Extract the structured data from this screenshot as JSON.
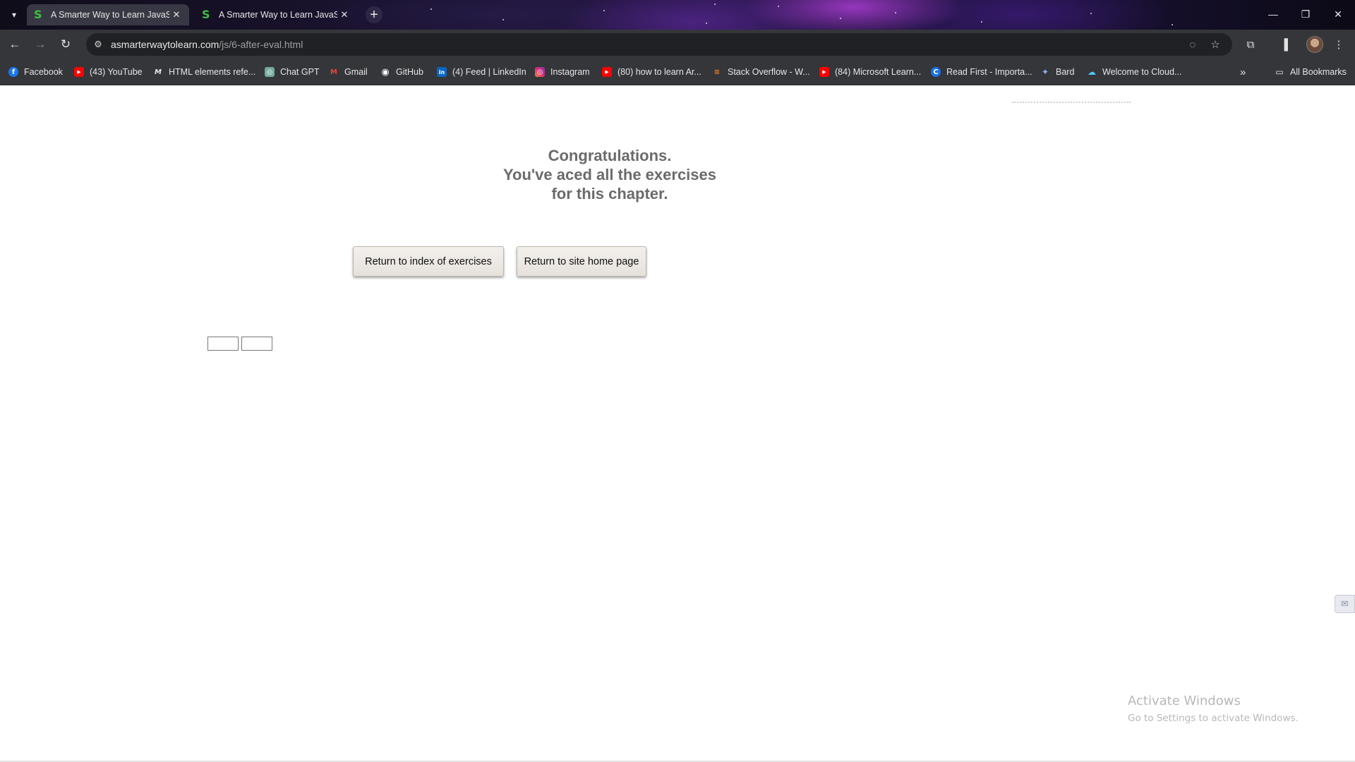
{
  "browser": {
    "tabs": [
      {
        "title": "A Smarter Way to Learn JavaScr",
        "favicon": "S",
        "active": true
      },
      {
        "title": "A Smarter Way to Learn JavaScr",
        "favicon": "S",
        "active": false
      }
    ],
    "url_domain": "asmarterwaytolearn.com",
    "url_path": "/js/6-after-eval.html",
    "icons": {
      "tab_dropdown": "chevron-down-icon",
      "new_tab": "plus-icon",
      "back": "arrow-left-icon",
      "forward": "arrow-right-icon",
      "reload": "reload-icon",
      "site_info": "tune-icon",
      "eye_off": "eye-off-icon",
      "star": "star-icon",
      "extensions": "puzzle-icon",
      "side_panel": "side-panel-icon",
      "menu": "kebab-menu-icon",
      "minimize": "minimize-icon",
      "restore": "restore-icon",
      "close": "close-icon"
    }
  },
  "bookmarks": [
    {
      "label": "Facebook",
      "icon": "facebook-icon",
      "color": "#1877f2",
      "glyph": "f"
    },
    {
      "label": "(43) YouTube",
      "icon": "youtube-icon",
      "color": "#ff0000",
      "glyph": "▶"
    },
    {
      "label": "HTML elements refe...",
      "icon": "mdn-icon",
      "color": "#35363a",
      "glyph": "M"
    },
    {
      "label": "Chat GPT",
      "icon": "chatgpt-icon",
      "color": "#74aa9c",
      "glyph": "◎"
    },
    {
      "label": "Gmail",
      "icon": "gmail-icon",
      "color": "#35363a",
      "glyph": "M"
    },
    {
      "label": "GitHub",
      "icon": "github-icon",
      "color": "#35363a",
      "glyph": "◉"
    },
    {
      "label": "(4) Feed | LinkedIn",
      "icon": "linkedin-icon",
      "color": "#0a66c2",
      "glyph": "in"
    },
    {
      "label": "Instagram",
      "icon": "instagram-icon",
      "color": "#e1306c",
      "glyph": "◎"
    },
    {
      "label": "(80) how to learn Ar...",
      "icon": "youtube-icon",
      "color": "#ff0000",
      "glyph": "▶"
    },
    {
      "label": "Stack Overflow - W...",
      "icon": "stackoverflow-icon",
      "color": "#35363a",
      "glyph": "≡"
    },
    {
      "label": "(84) Microsoft Learn...",
      "icon": "youtube-icon",
      "color": "#ff0000",
      "glyph": "▶"
    },
    {
      "label": "Read First - Importa...",
      "icon": "c-icon",
      "color": "#1a73e8",
      "glyph": "C"
    },
    {
      "label": "Bard",
      "icon": "bard-icon",
      "color": "#35363a",
      "glyph": "✦"
    },
    {
      "label": "Welcome to Cloud...",
      "icon": "cloud-icon",
      "color": "#35363a",
      "glyph": "☁"
    }
  ],
  "all_bookmarks_label": "All Bookmarks",
  "content": {
    "congrats_lines": [
      "Congratulations.",
      "You've aced all the exercises",
      "for this chapter."
    ],
    "button_index": "Return to index of exercises",
    "button_home": "Return to site home page"
  },
  "watermark": {
    "title": "Activate Windows",
    "subtitle": "Go to Settings to activate Windows."
  }
}
